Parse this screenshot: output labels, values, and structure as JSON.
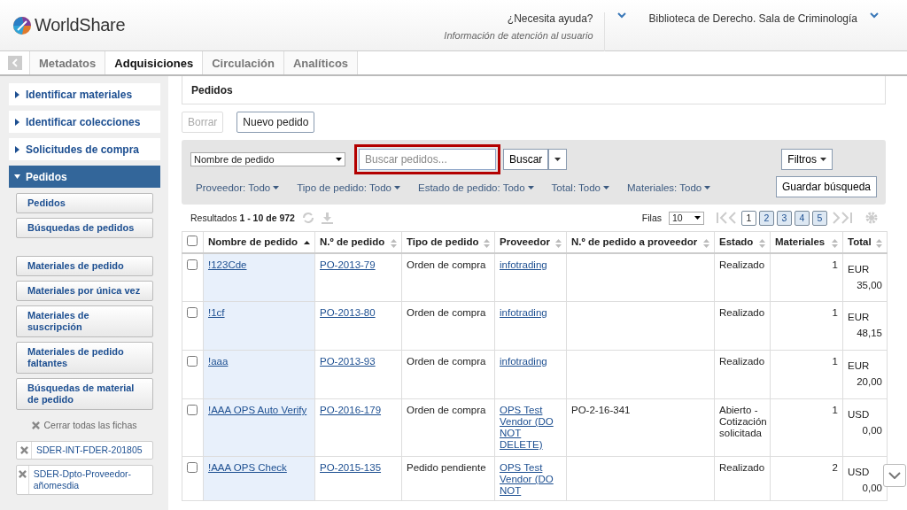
{
  "header": {
    "logo": "WorldShare",
    "help": {
      "title": "¿Necesita ayuda?",
      "subtitle": "Información de atención al usuario"
    },
    "institution": "Biblioteca de Derecho. Sala de Criminología"
  },
  "tabs": [
    {
      "label": "Metadatos",
      "selected": false
    },
    {
      "label": "Adquisiciones",
      "selected": true
    },
    {
      "label": "Circulación",
      "selected": false
    },
    {
      "label": "Analíticos",
      "selected": false
    }
  ],
  "sidebar": {
    "sections": [
      {
        "label": "Identificar materiales",
        "expanded": false
      },
      {
        "label": "Identificar colecciones",
        "expanded": false
      },
      {
        "label": "Solicitudes de compra",
        "expanded": false
      },
      {
        "label": "Pedidos",
        "expanded": true,
        "groups": [
          [
            "Pedidos",
            "Búsquedas de pedidos"
          ],
          [
            "Materiales de pedido",
            "Materiales por única vez",
            "Materiales de suscripción",
            "Materiales de pedido faltantes",
            "Búsquedas de material de pedido"
          ]
        ]
      }
    ],
    "close_all": "Cerrar todas las fichas",
    "open_records": [
      "SDER-INT-FDER-201805",
      "SDER-Dpto-Proveedor-añomesdia"
    ]
  },
  "page_title": "Pedidos",
  "actions": [
    {
      "label": "Borrar",
      "disabled": true
    },
    {
      "label": "Nuevo pedido",
      "disabled": false
    }
  ],
  "search": {
    "field": "Nombre de pedido",
    "placeholder": "Buscar pedidos...",
    "highlighted": true,
    "button": "Buscar",
    "filters_button": "Filtros",
    "save_button": "Guardar búsqueda"
  },
  "filters": [
    "Proveedor: Todo",
    "Tipo de pedido: Todo",
    "Estado de pedido: Todo",
    "Total: Todo",
    "Materiales: Todo"
  ],
  "results": "Resultados **1 - 10 de 972**",
  "rows_label": "Filas",
  "rows_value": "10",
  "pages": [
    {
      "label": "1",
      "selected": true
    },
    {
      "label": "2",
      "selected": false
    },
    {
      "label": "3",
      "selected": false
    },
    {
      "label": "4",
      "selected": false
    },
    {
      "label": "5",
      "selected": false
    }
  ],
  "table": {
    "select_all_checked": false,
    "columns": [
      {
        "label": "Nombre de pedido",
        "sorted": true
      },
      {
        "label": "N.º de pedido",
        "sorted": false
      },
      {
        "label": "Tipo de pedido",
        "sorted": false
      },
      {
        "label": "Proveedor",
        "sorted": false
      },
      {
        "label": "N.º de pedido a proveedor",
        "sorted": false
      },
      {
        "label": "Estado",
        "sorted": false
      },
      {
        "label": "Materiales",
        "sorted": false
      },
      {
        "label": "Total",
        "sorted": false
      }
    ],
    "rows": [
      {
        "checked": false,
        "name": "!123Cde",
        "number": "PO-2013-79",
        "type": "Orden de compra",
        "vendor": "infotrading",
        "vendor_number": "",
        "status": "Realizado",
        "items": "1",
        "currency": "EUR",
        "amount": "35,00"
      },
      {
        "checked": false,
        "name": "!1cf",
        "number": "PO-2013-80",
        "type": "Orden de compra",
        "vendor": "infotrading",
        "vendor_number": "",
        "status": "Realizado",
        "items": "1",
        "currency": "EUR",
        "amount": "48,15"
      },
      {
        "checked": false,
        "name": "!aaa",
        "number": "PO-2013-93",
        "type": "Orden de compra",
        "vendor": "infotrading",
        "vendor_number": "",
        "status": "Realizado",
        "items": "1",
        "currency": "EUR",
        "amount": "20,00"
      },
      {
        "checked": false,
        "name": "!AAA OPS Auto Verify",
        "number": "PO-2016-179",
        "type": "Orden de compra",
        "vendor": "OPS Test Vendor (DO NOT DELETE)",
        "vendor_number": "PO-2-16-341",
        "status": "Abierto - Cotización solicitada",
        "items": "1",
        "currency": "USD",
        "amount": "0,00"
      },
      {
        "checked": false,
        "name": "!AAA OPS Check",
        "number": "PO-2015-135",
        "type": "Pedido pendiente",
        "vendor": "OPS Test Vendor (DO NOT",
        "vendor_number": "",
        "status": "Realizado",
        "items": "2",
        "currency": "USD",
        "amount": "0,00"
      }
    ]
  }
}
